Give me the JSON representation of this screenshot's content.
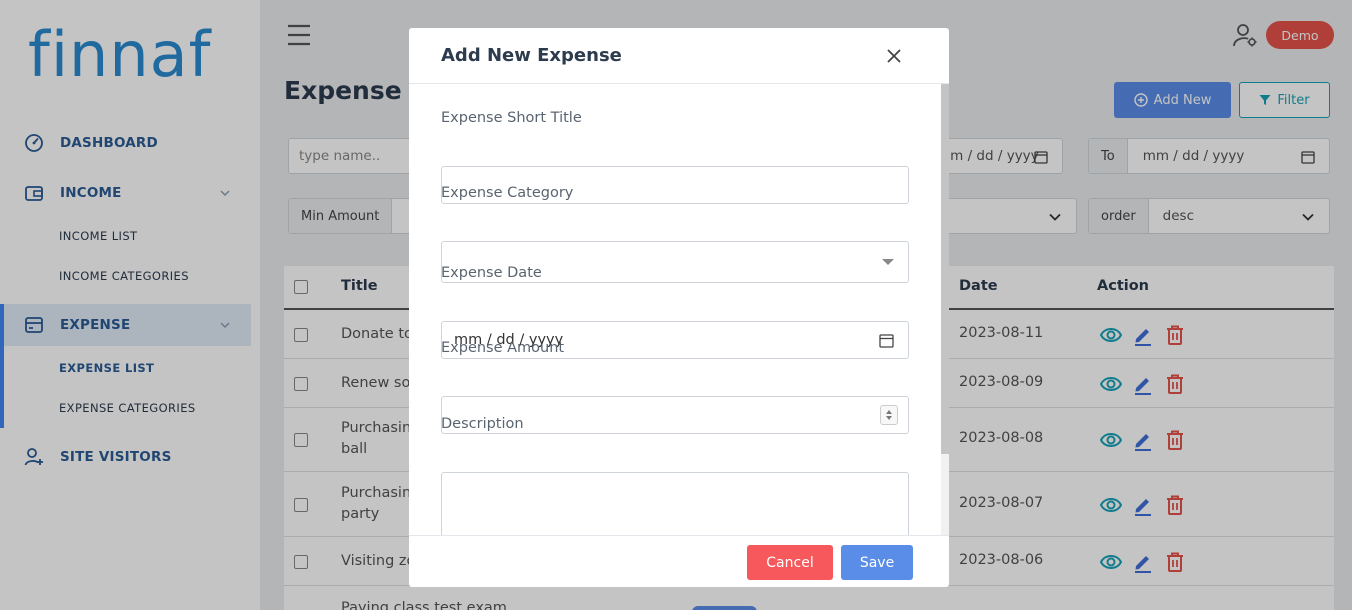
{
  "brand": {
    "logo_text": "finnaf"
  },
  "sidebar": {
    "items": [
      {
        "label": "DASHBOARD",
        "icon": "gauge-icon"
      },
      {
        "label": "INCOME",
        "icon": "wallet-icon",
        "sub": [
          "INCOME LIST",
          "INCOME CATEGORIES"
        ]
      },
      {
        "label": "EXPENSE",
        "icon": "card-icon",
        "sub": [
          "EXPENSE LIST",
          "EXPENSE CATEGORIES"
        ]
      },
      {
        "label": "SITE VISITORS",
        "icon": "user-plus-icon"
      }
    ]
  },
  "header": {
    "user_badge": "Demo"
  },
  "page": {
    "title": "Expense List",
    "add_label": "Add New",
    "filter_label": "Filter"
  },
  "filters": {
    "search_placeholder": "type name..",
    "from_date": "mm / dd / yyyy",
    "to_label": "To",
    "to_date": "mm / dd / yyyy",
    "min_amount_label": "Min Amount",
    "order_label": "order",
    "order_value": "desc"
  },
  "table": {
    "headers": {
      "title": "Title",
      "date": "Date",
      "action": "Action"
    },
    "rows": [
      {
        "title": "Donate to",
        "date": "2023-08-11"
      },
      {
        "title": "Renew so",
        "date": "2023-08-09"
      },
      {
        "title": "Purchasin\nball",
        "date": "2023-08-08"
      },
      {
        "title": "Purchasin\nparty",
        "date": "2023-08-07"
      },
      {
        "title": "Visiting zo",
        "date": "2023-08-06"
      },
      {
        "title": "Paying class test exam",
        "date": ""
      }
    ]
  },
  "modal": {
    "title": "Add New Expense",
    "fields": {
      "short_title_label": "Expense Short Title",
      "short_title_value": "",
      "category_label": "Expense Category",
      "category_value": "",
      "date_label": "Expense Date",
      "date_value": "mm / dd / yyyy",
      "amount_label": "Expense Amount",
      "amount_value": "",
      "description_label": "Description",
      "description_value": ""
    },
    "cancel_label": "Cancel",
    "save_label": "Save"
  },
  "colors": {
    "brand": "#2a8bd1",
    "primary": "#5a8de8",
    "danger": "#f6585b",
    "info": "#17a2b8",
    "view_icon": "#17a2b8",
    "edit_icon": "#3f6fd8",
    "delete_icon": "#e5534b"
  }
}
